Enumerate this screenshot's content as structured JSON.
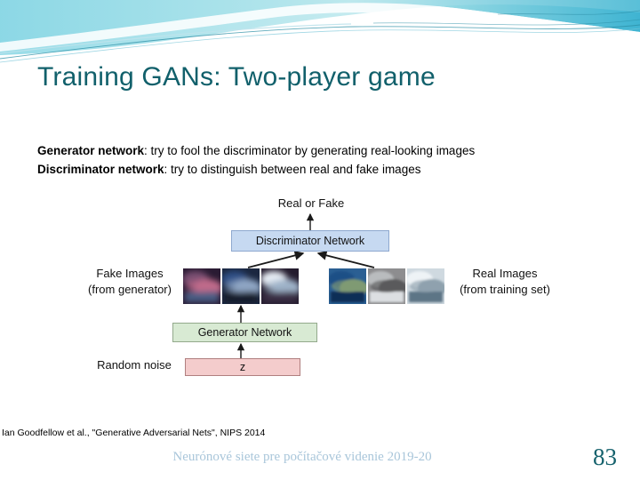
{
  "slide": {
    "title": "Training GANs: Two-player game",
    "body_lines": [
      {
        "bold": "Generator network",
        "rest": ": try to fool the discriminator by generating real-looking images"
      },
      {
        "bold": "Discriminator network",
        "rest": ": try to distinguish between real and fake images"
      }
    ],
    "citation": "Ian Goodfellow et al., \"Generative  Adversarial Nets\", NIPS 2014",
    "footer": "Neurónové siete pre počítačové videnie 2019-20",
    "page_number": "83"
  },
  "diagram": {
    "real_or_fake": "Real or Fake",
    "discriminator_box": "Discriminator Network",
    "generator_box": "Generator Network",
    "z_box": "z",
    "random_noise": "Random noise",
    "fake_images_line1": "Fake Images",
    "fake_images_line2": "(from generator)",
    "real_images_line1": "Real Images",
    "real_images_line2": "(from training set)",
    "fake_thumbs": [
      {
        "name": "blurry-crowd-purple",
        "base": "#2a1b33",
        "blob1": "#7a4f72",
        "blob2": "#c06a8a",
        "blob3": "#4a5d84"
      },
      {
        "name": "blurry-dark-blue-car",
        "base": "#1b2740",
        "blob1": "#2f4f86",
        "blob2": "#8fa6c4",
        "blob3": "#121a2b"
      },
      {
        "name": "blurry-white-car-dark-bg",
        "base": "#241c2e",
        "blob1": "#e8eef5",
        "blob2": "#9fb3c9",
        "blob3": "#3a2f45"
      }
    ],
    "real_thumbs": [
      {
        "name": "blue-sedan-photo",
        "base": "#2b5f93",
        "blob1": "#1d4f86",
        "blob2": "#7f9a73",
        "blob3": "#0f2f56"
      },
      {
        "name": "silver-sedan-photo",
        "base": "#8d8d8f",
        "blob1": "#b9bcbe",
        "blob2": "#5a5a5c",
        "blob3": "#dcdfe2"
      },
      {
        "name": "white-car-photo",
        "base": "#cfd9e0",
        "blob1": "#eef3f6",
        "blob2": "#8fa2ae",
        "blob3": "#5d7486"
      }
    ]
  },
  "colors": {
    "title_teal": "#11606b",
    "wave_cyan": "#55c8da",
    "discriminator_blue": "#c6d9f1",
    "generator_green": "#d8ead3",
    "z_pink": "#f4cccc",
    "footer_blue": "#a9c6da"
  }
}
